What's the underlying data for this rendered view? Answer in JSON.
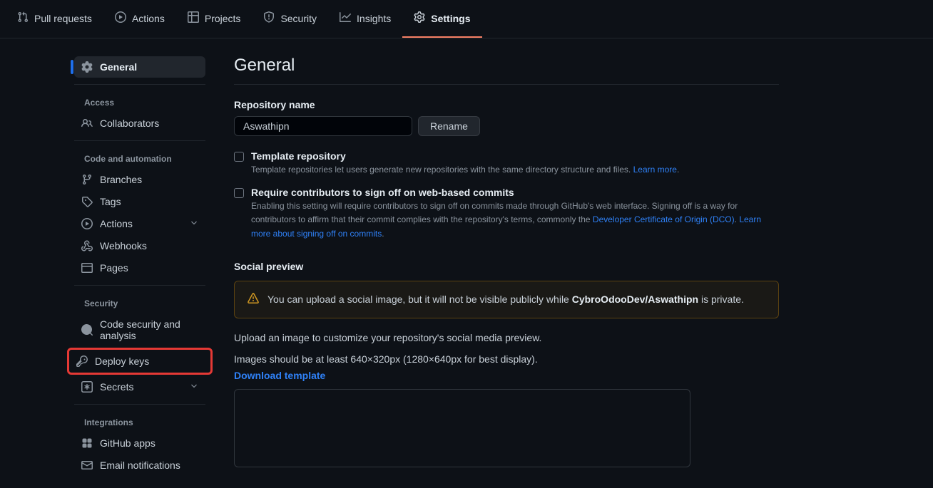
{
  "topnav": {
    "items": [
      {
        "label": "Pull requests"
      },
      {
        "label": "Actions"
      },
      {
        "label": "Projects"
      },
      {
        "label": "Security"
      },
      {
        "label": "Insights"
      },
      {
        "label": "Settings"
      }
    ]
  },
  "sidebar": {
    "general": "General",
    "headings": {
      "access": "Access",
      "code": "Code and automation",
      "security": "Security",
      "integrations": "Integrations"
    },
    "access": {
      "collaborators": "Collaborators"
    },
    "code": {
      "branches": "Branches",
      "tags": "Tags",
      "actions": "Actions",
      "webhooks": "Webhooks",
      "pages": "Pages"
    },
    "security": {
      "code_security": "Code security and analysis",
      "deploy_keys": "Deploy keys",
      "secrets": "Secrets"
    },
    "integrations": {
      "github_apps": "GitHub apps",
      "email_notifications": "Email notifications"
    }
  },
  "main": {
    "title": "General",
    "repo_name_label": "Repository name",
    "repo_name_value": "Aswathipn",
    "rename_btn": "Rename",
    "template": {
      "label": "Template repository",
      "desc": "Template repositories let users generate new repositories with the same directory structure and files. ",
      "learn_more": "Learn more"
    },
    "signoff": {
      "label": "Require contributors to sign off on web-based commits",
      "desc1": "Enabling this setting will require contributors to sign off on commits made through GitHub's web interface. Signing off is a way for contributors to affirm that their commit complies with the repository's terms, commonly the ",
      "link1": "Developer Certificate of Origin (DCO)",
      "desc2": ". ",
      "link2": "Learn more about signing off on commits",
      "desc3": "."
    },
    "social": {
      "heading": "Social preview",
      "warning_pre": "You can upload a social image, but it will not be visible publicly while ",
      "warning_repo": "CybroOdooDev/Aswathipn",
      "warning_post": " is private.",
      "upload_text": "Upload an image to customize your repository's social media preview.",
      "dimensions_text": "Images should be at least 640×320px (1280×640px for best display).",
      "download_template": "Download template"
    }
  }
}
